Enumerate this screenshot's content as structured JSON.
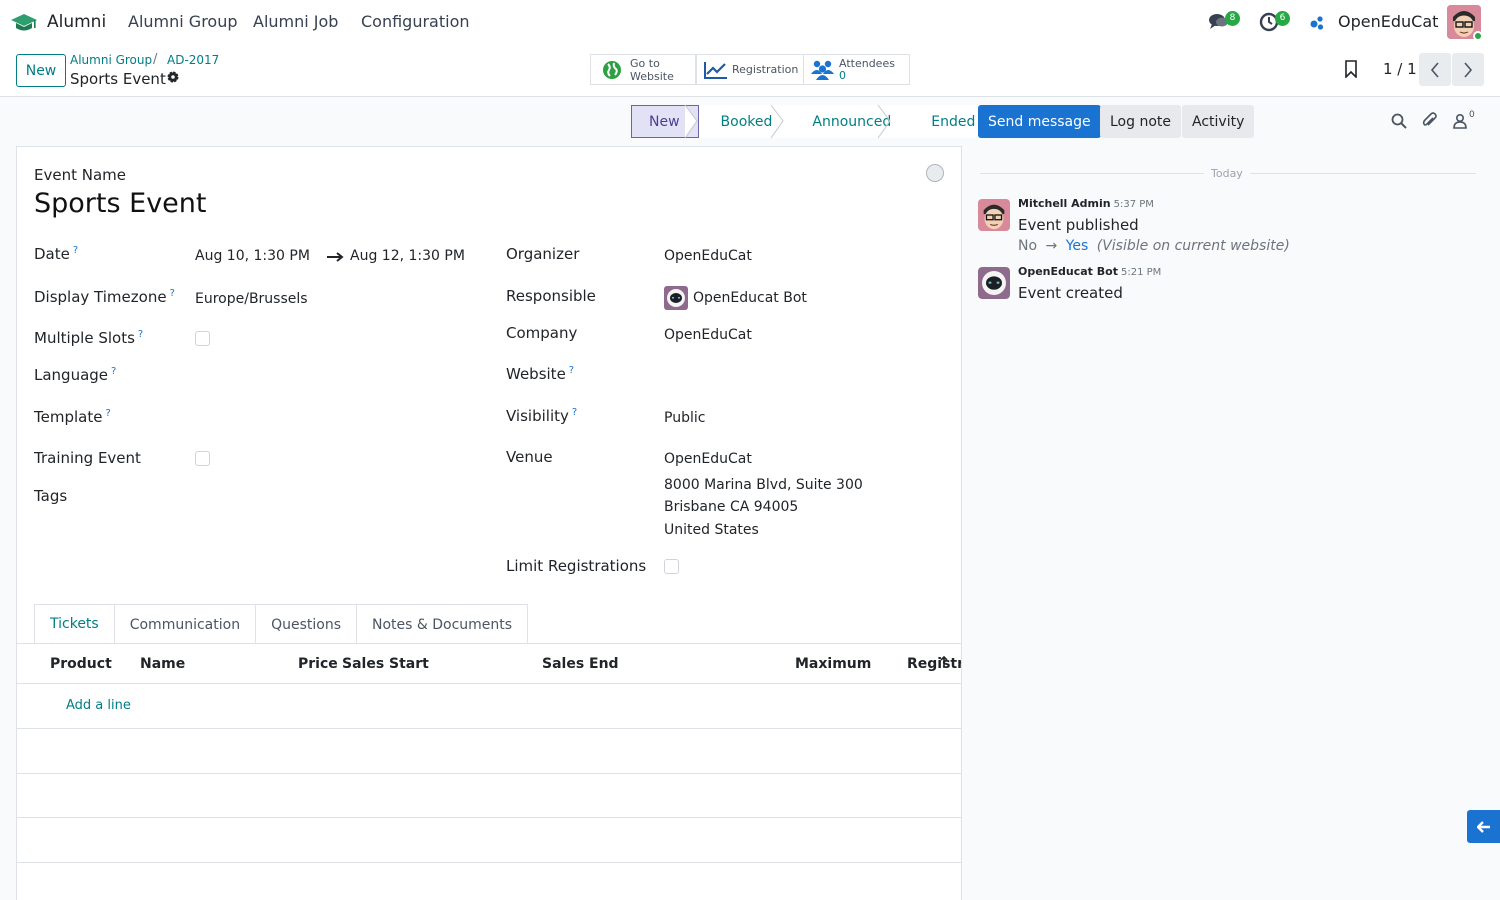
{
  "navbar": {
    "app_name": "Alumni",
    "menu": [
      "Alumni Group",
      "Alumni Job",
      "Configuration"
    ],
    "messages_count": "8",
    "activities_count": "6",
    "company": "OpenEduCat"
  },
  "control_panel": {
    "new_label": "New",
    "breadcrumb": [
      "Alumni Group",
      "AD-2017"
    ],
    "current": "Sports Event",
    "smart_buttons": {
      "website": {
        "line1": "Go to",
        "line2": "Website"
      },
      "registration": "Registration",
      "attendees": {
        "label": "Attendees",
        "value": "0"
      }
    },
    "pager": "1 / 1"
  },
  "statusbar": {
    "stages": [
      "New",
      "Booked",
      "Announced",
      "Ended"
    ],
    "active": "New"
  },
  "chatter_buttons": {
    "send_message": "Send message",
    "log_note": "Log note",
    "activity": "Activity",
    "followers_count": "0"
  },
  "form": {
    "event_name_label": "Event Name",
    "event_name": "Sports Event",
    "left": {
      "date_label": "Date",
      "date_start": "Aug 10, 1:30 PM",
      "date_end": "Aug 12, 1:30 PM",
      "timezone_label": "Display Timezone",
      "timezone": "Europe/Brussels",
      "multi_slots_label": "Multiple Slots",
      "language_label": "Language",
      "template_label": "Template",
      "training_label": "Training Event",
      "tags_label": "Tags"
    },
    "right": {
      "organizer_label": "Organizer",
      "organizer": "OpenEduCat",
      "responsible_label": "Responsible",
      "responsible": "OpenEducat Bot",
      "company_label": "Company",
      "company": "OpenEduCat",
      "website_label": "Website",
      "visibility_label": "Visibility",
      "visibility": "Public",
      "venue_label": "Venue",
      "venue_lines": [
        "OpenEduCat",
        "8000 Marina Blvd, Suite 300",
        "Brisbane CA 94005",
        "United States"
      ],
      "limit_label": "Limit Registrations"
    },
    "help_mark": "?",
    "tabs": [
      "Tickets",
      "Communication",
      "Questions",
      "Notes & Documents"
    ],
    "ticket_columns": [
      "Product",
      "Name",
      "Price",
      "Sales Start",
      "Sales End",
      "Maximum",
      "Registra"
    ],
    "add_line": "Add a line"
  },
  "chatter": {
    "day": "Today",
    "messages": [
      {
        "author": "Mitchell Admin",
        "time": "5:37 PM",
        "body": "Event published",
        "tracking_old": "No",
        "tracking_new": "Yes",
        "tracking_field": "(Visible on current website)"
      },
      {
        "author": "OpenEducat Bot",
        "time": "5:21 PM",
        "body": "Event created"
      }
    ]
  },
  "colors": {
    "primary": "#017e84",
    "action": "#1a73d0",
    "badge": "#28a745"
  }
}
